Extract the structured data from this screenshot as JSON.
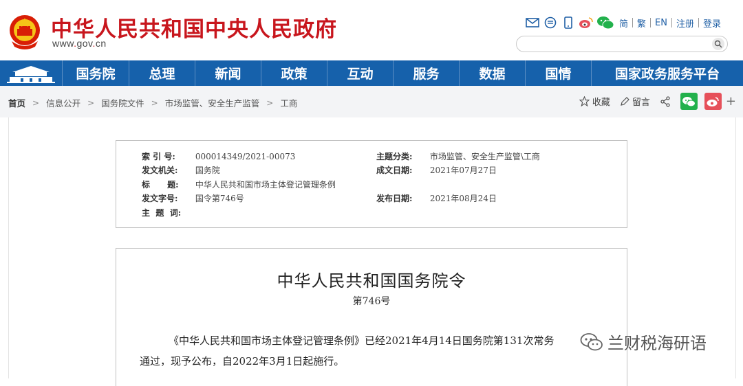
{
  "header": {
    "site_title": "中华人民共和国中央人民政府",
    "site_url_prefix": "www",
    "site_url_dot1": ".",
    "site_url_mid": "gov",
    "site_url_dot2": ".",
    "site_url_suffix": "cn",
    "links": [
      "简",
      "繁",
      "EN",
      "注册",
      "登录"
    ],
    "search_placeholder": ""
  },
  "nav": {
    "items": [
      "国务院",
      "总理",
      "新闻",
      "政策",
      "互动",
      "服务",
      "数据",
      "国情",
      "国家政务服务平台"
    ]
  },
  "breadcrumb": {
    "items": [
      "首页",
      "信息公开",
      "国务院文件",
      "市场监管、安全生产监管",
      "工商"
    ]
  },
  "share": {
    "favorite": "收藏",
    "comment": "留言",
    "more": "+"
  },
  "info": {
    "left": [
      {
        "label": "索  引  号:",
        "value": "000014349/2021-00073"
      },
      {
        "label": "发文机关:",
        "value": "国务院"
      },
      {
        "label": "标      题:",
        "value": "中华人民共和国市场主体登记管理条例"
      },
      {
        "label": "发文字号:",
        "value": "国令第746号"
      },
      {
        "label": "主  题  词:",
        "value": ""
      }
    ],
    "right": [
      {
        "label": "主题分类:",
        "value": "市场监管、安全生产监管\\工商"
      },
      {
        "label": "成文日期:",
        "value": "2021年07月27日"
      },
      {
        "label": "发布日期:",
        "value": "2021年08月24日"
      }
    ]
  },
  "document": {
    "title": "中华人民共和国国务院令",
    "number": "第746号",
    "para1": "《中华人民共和国市场主体登记管理条例》已经2021年4月14日国务院第131次常务",
    "para2": "通过，现予公布，自2022年3月1日起施行。"
  },
  "watermark": {
    "text": "兰财税海研语"
  },
  "colors": {
    "brand_red": "#c8161d",
    "nav_blue": "#1661ab",
    "link_blue": "#1f5fa5",
    "wechat_green": "#22b14c",
    "weibo_red": "#e6505a"
  }
}
